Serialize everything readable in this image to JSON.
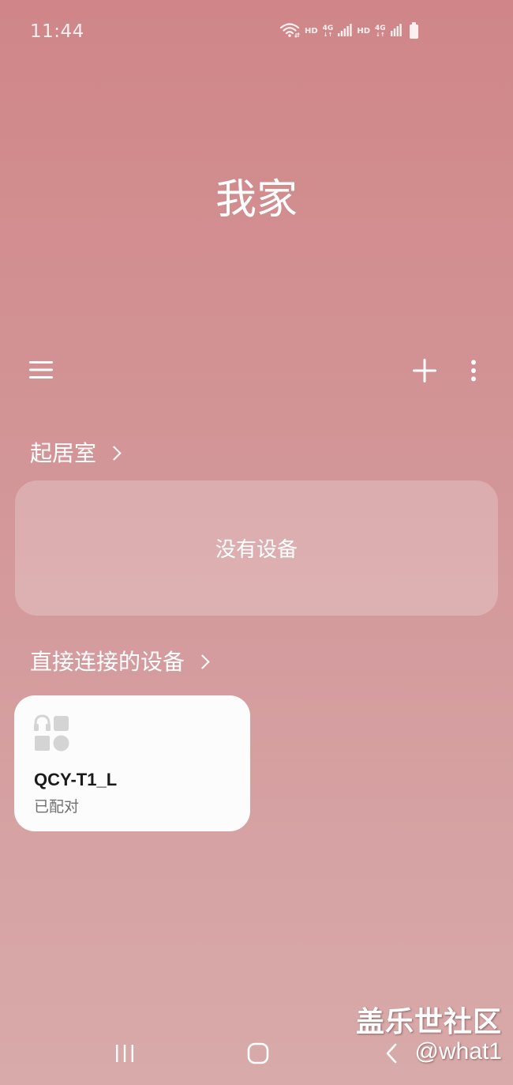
{
  "status_bar": {
    "time": "11:44",
    "hd_label_1": "HD",
    "net_label_1": "4G",
    "hd_label_2": "HD",
    "net_label_2": "4G",
    "icons": [
      "wifi-icon",
      "signal-icon",
      "signal-icon",
      "battery-icon"
    ]
  },
  "header": {
    "title": "我家"
  },
  "toolbar": {
    "menu_icon": "hamburger-menu-icon",
    "add_icon": "plus-icon",
    "more_icon": "more-vertical-icon"
  },
  "rooms": [
    {
      "name": "起居室",
      "empty_text": "没有设备"
    }
  ],
  "direct_devices": {
    "header": "直接连接的设备",
    "devices": [
      {
        "name": "QCY-T1_L",
        "status": "已配对",
        "icon": "headphones-device-icon"
      }
    ]
  },
  "watermark": {
    "title": "盖乐世社区",
    "user": "@what1"
  },
  "nav_bar": {
    "icons": [
      "recent-apps-icon",
      "home-icon",
      "back-icon"
    ]
  },
  "colors": {
    "background_top": "#d08688",
    "background_bottom": "#d8aaaa",
    "card": "#fdfcfc",
    "text_primary": "#ffffff",
    "device_name": "#1a1a1a",
    "device_status": "#707070"
  }
}
